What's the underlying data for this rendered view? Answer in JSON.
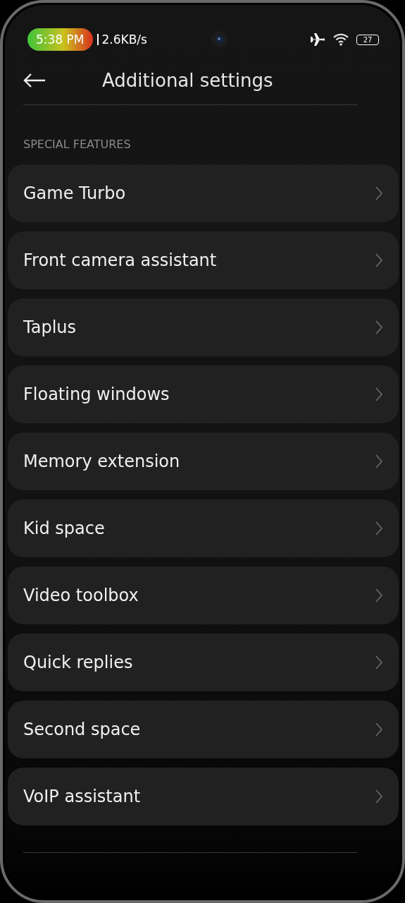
{
  "status_bar": {
    "time": "5:38 PM",
    "speed": "2.6KB/s",
    "battery": "27"
  },
  "header": {
    "title": "Additional settings"
  },
  "section": {
    "title": "SPECIAL FEATURES"
  },
  "items": [
    {
      "label": "Game Turbo"
    },
    {
      "label": "Front camera assistant"
    },
    {
      "label": "Taplus"
    },
    {
      "label": "Floating windows"
    },
    {
      "label": "Memory extension"
    },
    {
      "label": "Kid space"
    },
    {
      "label": "Video toolbox"
    },
    {
      "label": "Quick replies"
    },
    {
      "label": "Second space"
    },
    {
      "label": "VoIP assistant"
    }
  ]
}
